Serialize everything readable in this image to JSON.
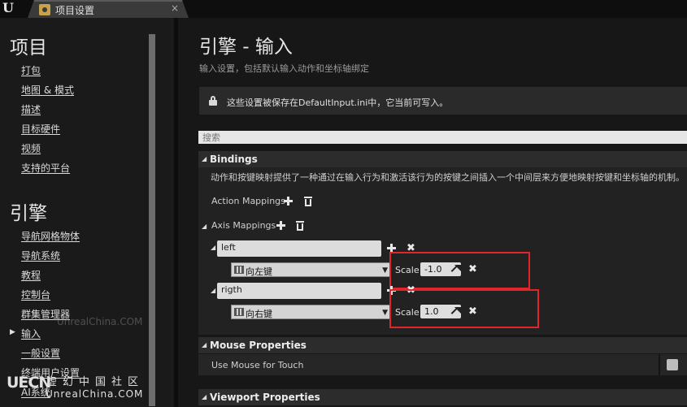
{
  "tab": {
    "title": "项目设置",
    "close": "×"
  },
  "sidebar": {
    "section_project": "项目",
    "project_items": [
      "打包",
      "地图 & 模式",
      "描述",
      "目标硬件",
      "视频",
      "支持的平台"
    ],
    "section_engine": "引擎",
    "engine_items": [
      "导航网格物体",
      "导航系统",
      "教程",
      "控制台",
      "群集管理器",
      "输入",
      "一般设置",
      "终端用户设置",
      "AI系统"
    ],
    "selected_item": "输入"
  },
  "main": {
    "title": "引擎 - 输入",
    "subtitle": "输入设置，包括默认输入动作和坐标轴绑定",
    "notice": "这些设置被保存在DefaultInput.ini中，它当前可写入。",
    "search_placeholder": "搜索"
  },
  "bindings": {
    "header": "Bindings",
    "description": "动作和按键映射提供了一种通过在输入行为和激活该行为的按键之间插入一个中间层来方便地映射按键和坐标轴的机制。",
    "action_mappings_label": "Action Mappings",
    "axis_mappings_label": "Axis Mappings",
    "axis_mappings": [
      {
        "name": "left",
        "key": "向左键",
        "scale_label": "Scale",
        "scale": "-1.0"
      },
      {
        "name": "rigth",
        "key": "向右键",
        "scale_label": "Scale",
        "scale": "1.0"
      }
    ]
  },
  "mouse_properties": {
    "header": "Mouse Properties",
    "use_mouse_for_touch_label": "Use Mouse for Touch",
    "use_mouse_for_touch": false
  },
  "viewport_properties": {
    "header": "Viewport Properties"
  },
  "watermark": {
    "overlay": "UnrealChina.COM",
    "logo": "UECN",
    "cn": "虚幻中国社区",
    "en": "UnrealChina.COM"
  },
  "colors": {
    "highlight": "#e0262b",
    "panel": "#171717",
    "sidebar": "#1a1a1a"
  }
}
